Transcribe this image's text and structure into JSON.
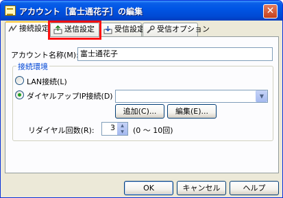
{
  "window": {
    "title": "アカウント［富士通花子］の編集",
    "close_glyph": "✕"
  },
  "tabs": [
    {
      "label": "接続設定",
      "icon": "connection-icon",
      "active": true
    },
    {
      "label": "送信設定",
      "icon": "send-icon",
      "active": false,
      "highlighted": true
    },
    {
      "label": "受信設定",
      "icon": "receive-icon",
      "active": false
    },
    {
      "label": "受信オプション",
      "icon": "options-icon",
      "active": false
    }
  ],
  "account": {
    "name_label": "アカウント名称(M):",
    "name_value": "富士通花子"
  },
  "connection_env": {
    "group_title": "接続環境",
    "lan_label": "LAN接続(L)",
    "lan_checked": false,
    "dialup_label": "ダイヤルアップIP接続(D)",
    "dialup_checked": true,
    "dialup_value": "",
    "add_button": "追加(C)...",
    "edit_button": "編集(E)...",
    "redial_label": "リダイヤル回数(R):",
    "redial_value": "3",
    "redial_range": "(0 ～ 10回)"
  },
  "footer": {
    "ok_button": "OK",
    "cancel_button": "キャンセル",
    "help_button": "ヘルプ"
  },
  "colors": {
    "titlebar": "#0055e5",
    "highlight": "#ff1111",
    "group_title": "#0046d5"
  }
}
